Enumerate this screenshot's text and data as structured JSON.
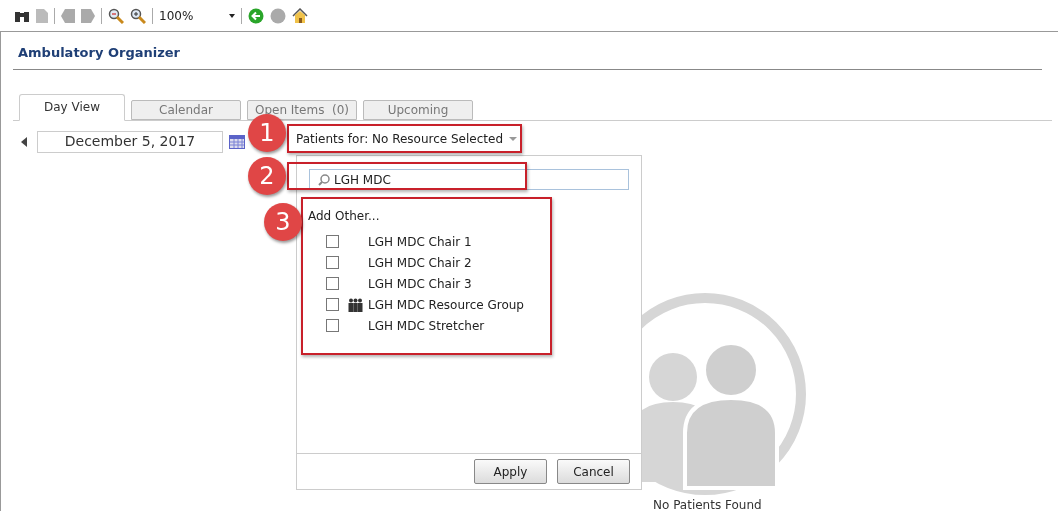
{
  "toolbar": {
    "zoom": "100%"
  },
  "title": "Ambulatory Organizer",
  "tabs": [
    {
      "label": "Day View",
      "selected": true
    },
    {
      "label": "Calendar",
      "selected": false
    },
    {
      "label": "Open Items  (0)",
      "selected": false
    },
    {
      "label": "Upcoming",
      "selected": false
    }
  ],
  "date": "December 5, 2017",
  "patients_for": {
    "label": "Patients for:",
    "value": "No Resource Selected"
  },
  "search": {
    "value": "LGH MDC"
  },
  "list": {
    "heading": "Add Other...",
    "items": [
      {
        "label": "LGH MDC Chair 1",
        "kind": "resource",
        "checked": false
      },
      {
        "label": "LGH MDC Chair 2",
        "kind": "resource",
        "checked": false
      },
      {
        "label": "LGH MDC Chair 3",
        "kind": "resource",
        "checked": false
      },
      {
        "label": "LGH MDC Resource Group",
        "kind": "group",
        "checked": false
      },
      {
        "label": "LGH MDC Stretcher",
        "kind": "resource",
        "checked": false
      }
    ]
  },
  "buttons": [
    "Apply",
    "Cancel"
  ],
  "empty_message": "No Patients Found",
  "callouts": [
    "1",
    "2",
    "3"
  ]
}
